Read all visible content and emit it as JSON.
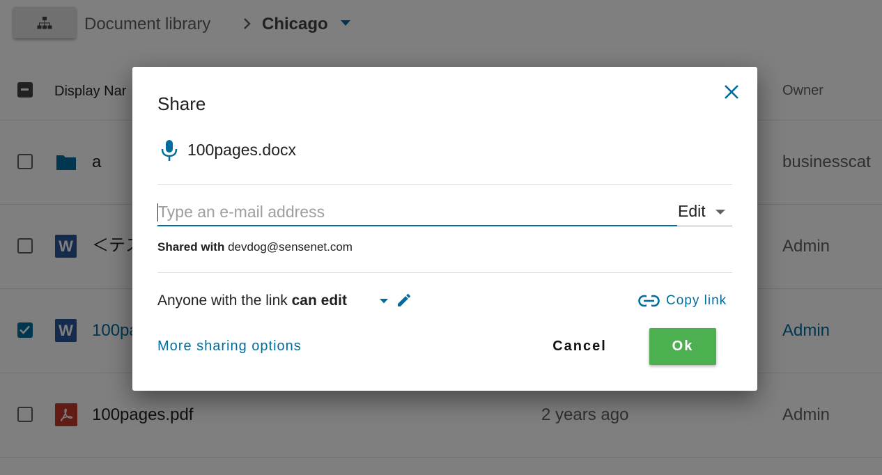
{
  "breadcrumb": {
    "root": "Document library",
    "current": "Chicago"
  },
  "table": {
    "headers": {
      "display_name": "Display Nar",
      "owner": "Owner"
    },
    "rows": [
      {
        "name": "a",
        "modified": "",
        "owner": "businesscat",
        "icon": "folder-icon",
        "checked": false
      },
      {
        "name": "＜テス",
        "modified": "",
        "owner": "Admin",
        "icon": "word-icon",
        "checked": false
      },
      {
        "name": "100pa",
        "modified": "",
        "owner": "Admin",
        "icon": "word-icon",
        "checked": true
      },
      {
        "name": "100pages.pdf",
        "modified": "2 years ago",
        "owner": "Admin",
        "icon": "pdf-icon",
        "checked": false
      }
    ]
  },
  "dialog": {
    "title": "Share",
    "filename": "100pages.docx",
    "email_placeholder": "Type an e-mail address",
    "email_value": "",
    "permission": "Edit",
    "shared_with_label": "Shared with",
    "shared_with_value": "devdog@sensenet.com",
    "link_prefix": "Anyone with the link",
    "link_permission": "can edit",
    "copy_link": "Copy link",
    "more_options": "More sharing options",
    "cancel": "Cancel",
    "ok": "Ok"
  },
  "colors": {
    "primary": "#016d9e",
    "ok_green": "#4caf50",
    "overlay": "rgba(0,0,0,0.5)"
  },
  "word_icon_letter": "W"
}
